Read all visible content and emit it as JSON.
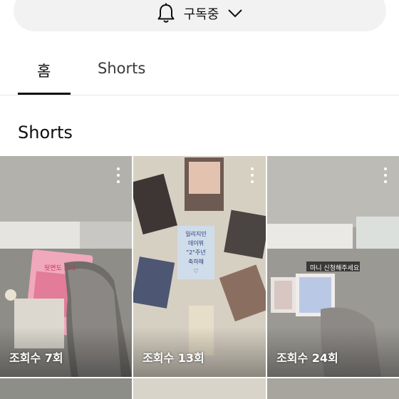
{
  "subscribe": {
    "label": "구독중",
    "bell_icon": "bell-icon",
    "chevron_icon": "chevron-down-icon"
  },
  "tabs": [
    {
      "label": "홈",
      "selected": true
    },
    {
      "label": "Shorts",
      "selected": false
    }
  ],
  "section": {
    "title": "Shorts"
  },
  "shorts": [
    {
      "views": "조회수 7회",
      "overlay_text": "뒷면도 조네"
    },
    {
      "views": "조회수 13회",
      "note_lines": [
        "일리지민",
        "데이뷔",
        "\"2\"주년",
        "축하해",
        "♡"
      ]
    },
    {
      "views": "조회수 24회",
      "overlay_text": "마니 신청해주세요"
    }
  ],
  "colors": {
    "pill_bg": "#f2f2f2",
    "text": "#0f0f0f",
    "divider": "#e5e5e5"
  }
}
